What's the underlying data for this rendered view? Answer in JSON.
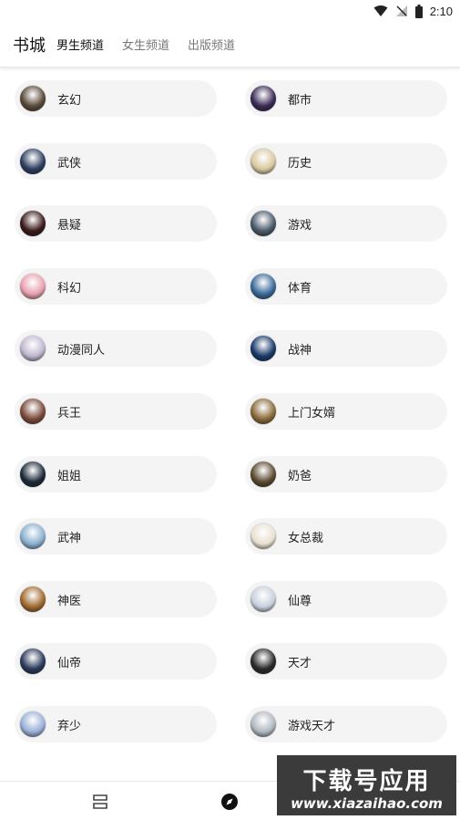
{
  "status_bar": {
    "time": "2:10"
  },
  "header": {
    "title": "书城",
    "tabs": [
      {
        "label": "男生频道",
        "active": true
      },
      {
        "label": "女生频道",
        "active": false
      },
      {
        "label": "出版频道",
        "active": false
      }
    ]
  },
  "categories": [
    {
      "label": "玄幻",
      "color": "#5a4a3a"
    },
    {
      "label": "都市",
      "color": "#3a2a55"
    },
    {
      "label": "武侠",
      "color": "#2c3e60"
    },
    {
      "label": "历史",
      "color": "#d9c8a0"
    },
    {
      "label": "悬疑",
      "color": "#3a1a1a"
    },
    {
      "label": "游戏",
      "color": "#4a5a6a"
    },
    {
      "label": "科幻",
      "color": "#e8a0b0"
    },
    {
      "label": "体育",
      "color": "#3a6a9a"
    },
    {
      "label": "动漫同人",
      "color": "#c0b8d0"
    },
    {
      "label": "战神",
      "color": "#1a3a6a"
    },
    {
      "label": "兵王",
      "color": "#7a4a3a"
    },
    {
      "label": "上门女婿",
      "color": "#8a6a3a"
    },
    {
      "label": "姐姐",
      "color": "#1e2a3a"
    },
    {
      "label": "奶爸",
      "color": "#5a4a30"
    },
    {
      "label": "武神",
      "color": "#8ab0d0"
    },
    {
      "label": "女总裁",
      "color": "#e8e0d0"
    },
    {
      "label": "神医",
      "color": "#a06a30"
    },
    {
      "label": "仙尊",
      "color": "#c8d0dc"
    },
    {
      "label": "仙帝",
      "color": "#2a3a5a"
    },
    {
      "label": "天才",
      "color": "#2a2a2a"
    },
    {
      "label": "弃少",
      "color": "#9ab0d8"
    },
    {
      "label": "游戏天才",
      "color": "#b0b8c0"
    }
  ],
  "bottom_nav": [
    {
      "icon": "bookshelf-icon"
    },
    {
      "icon": "compass-icon"
    }
  ],
  "watermark": {
    "line1": "下载号应用",
    "line2": "www.xiazaihao.com"
  }
}
